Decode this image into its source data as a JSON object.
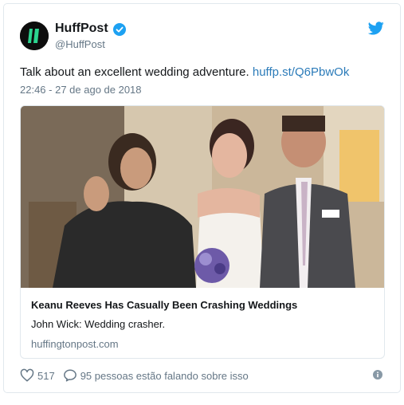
{
  "author": {
    "name": "HuffPost",
    "handle": "@HuffPost",
    "verified": true
  },
  "tweet": {
    "text": "Talk about an excellent wedding adventure.",
    "link": "huffp.st/Q6PbwOk",
    "timestamp": "22:46 - 27 de ago de 2018"
  },
  "card": {
    "title": "Keanu Reeves Has Casually Been Crashing Weddings",
    "description": "John Wick: Wedding crasher.",
    "domain": "huffingtonpost.com"
  },
  "actions": {
    "likes": "517",
    "conversation": "95 pessoas estão falando sobre isso"
  },
  "icons": {
    "avatar": "huffpost-logo",
    "verified": "verified-badge-icon",
    "brand": "twitter-bird-icon",
    "like": "heart-icon",
    "reply": "speech-bubble-icon",
    "info": "info-icon"
  },
  "colors": {
    "link": "#2b7bb9",
    "verified": "#1da1f2",
    "muted": "#657786",
    "avatar_green": "#2bd48f"
  }
}
